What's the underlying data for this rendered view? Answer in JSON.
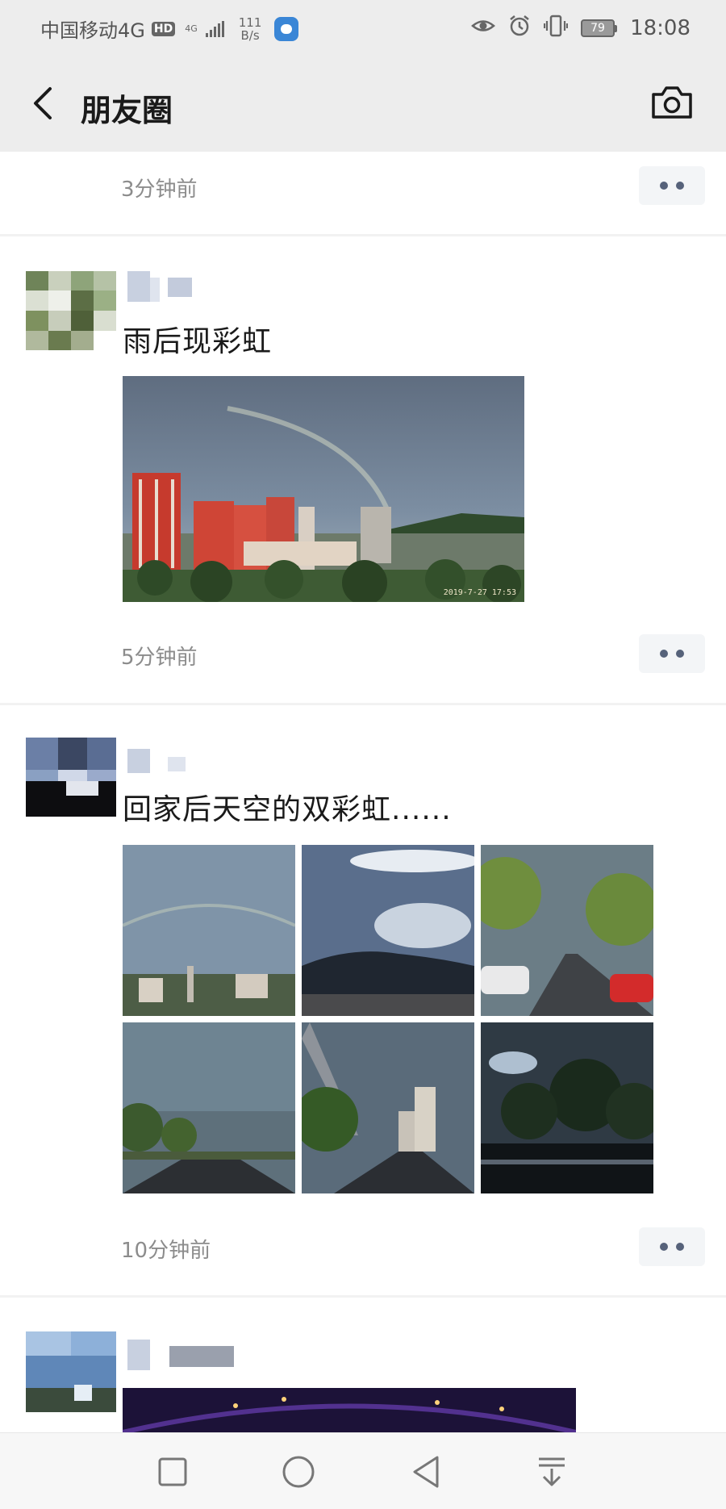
{
  "status_bar": {
    "carrier": "中国移动4G",
    "hd_badge": "HD",
    "network_type": "4G",
    "speed_value": "111",
    "speed_unit": "B/s",
    "battery": "79",
    "time": "18:08",
    "icons": [
      "eye-comfort-icon",
      "alarm-icon",
      "vibrate-icon",
      "battery-icon"
    ]
  },
  "nav": {
    "title": "朋友圈",
    "back_icon": "chevron-left-icon",
    "camera_icon": "camera-icon"
  },
  "posts": [
    {
      "time": "3分钟前"
    },
    {
      "text": "雨后现彩虹",
      "time": "5分钟前",
      "photo_count": 1,
      "photo_stamp": "2019-7-27 17:53"
    },
    {
      "text": "回家后天空的双彩虹......",
      "time": "10分钟前",
      "photo_count": 6
    },
    {
      "text": "",
      "photo_count": 1
    }
  ],
  "system_nav": {
    "icons": [
      "recents-square-icon",
      "home-circle-icon",
      "back-triangle-icon",
      "notification-pull-icon"
    ]
  },
  "colors": {
    "topbar_bg": "#ededed",
    "time_text": "#8c8c8c",
    "more_button_bg": "#f3f5f7",
    "more_dots": "#56627a"
  }
}
